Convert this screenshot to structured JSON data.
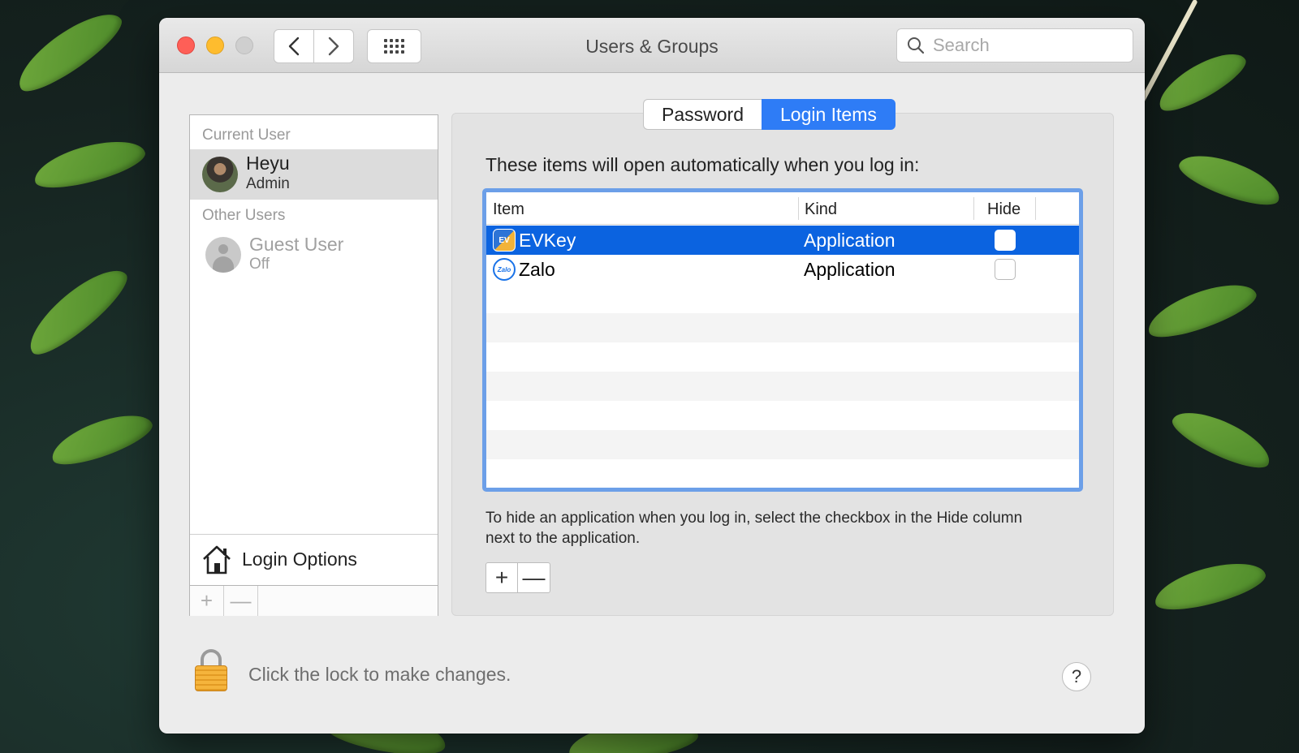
{
  "window": {
    "title": "Users & Groups"
  },
  "search": {
    "placeholder": "Search"
  },
  "sidebar": {
    "current_user_header": "Current User",
    "current_user": {
      "name": "Heyu",
      "role": "Admin"
    },
    "other_users_header": "Other Users",
    "guest": {
      "name": "Guest User",
      "status": "Off"
    },
    "login_options_label": "Login Options",
    "add_symbol": "+",
    "remove_symbol": "—"
  },
  "tabs": [
    {
      "label": "Password",
      "active": false
    },
    {
      "label": "Login Items",
      "active": true
    }
  ],
  "login_items": {
    "intro": "These items will open automatically when you log in:",
    "columns": {
      "item": "Item",
      "kind": "Kind",
      "hide": "Hide"
    },
    "rows": [
      {
        "name": "EVKey",
        "kind": "Application",
        "hide": false,
        "selected": true,
        "icon": "evkey-app-icon",
        "icon_text": "EV"
      },
      {
        "name": "Zalo",
        "kind": "Application",
        "hide": false,
        "selected": false,
        "icon": "zalo-app-icon",
        "icon_text": "Zalo"
      }
    ],
    "hint": "To hide an application when you log in, select the checkbox in the Hide column next to the application.",
    "add_symbol": "+",
    "remove_symbol": "—"
  },
  "footer": {
    "lock_text": "Click the lock to make changes.",
    "help_symbol": "?"
  },
  "colors": {
    "accent": "#2e7cf6",
    "selection": "#0b63e0",
    "focus_ring": "#6c9fe8"
  }
}
